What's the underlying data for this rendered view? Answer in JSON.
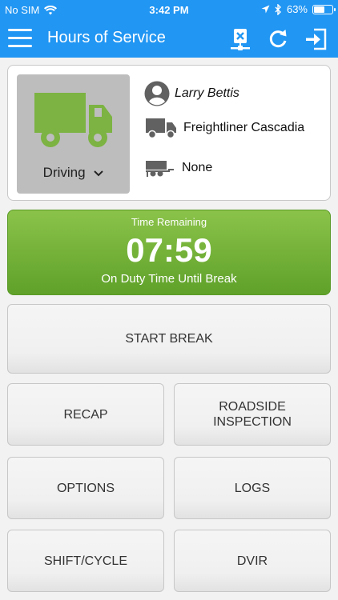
{
  "status_bar": {
    "carrier": "No SIM",
    "time": "3:42 PM",
    "battery_percent": "63%",
    "battery_level": 0.63
  },
  "nav": {
    "title": "Hours of Service",
    "icons": [
      "menu-icon",
      "disconnect-device-icon",
      "refresh-icon",
      "logout-icon"
    ]
  },
  "status_card": {
    "duty_status": "Driving",
    "driver_name": "Larry Bettis",
    "vehicle": "Freightliner Cascadia",
    "trailer": "None",
    "truck_color": "#7cb342"
  },
  "timer": {
    "label": "Time Remaining",
    "value": "07:59",
    "subtitle": "On Duty Time Until Break",
    "color": "#7cb342"
  },
  "buttons": {
    "start_break": "START BREAK",
    "recap": "RECAP",
    "roadside_line1": "ROADSIDE",
    "roadside_line2": "INSPECTION",
    "options": "OPTIONS",
    "logs": "LOGS",
    "shift_cycle": "SHIFT/CYCLE",
    "dvir": "DVIR"
  },
  "colors": {
    "primary": "#2196f3",
    "background": "#f2f2f2"
  }
}
